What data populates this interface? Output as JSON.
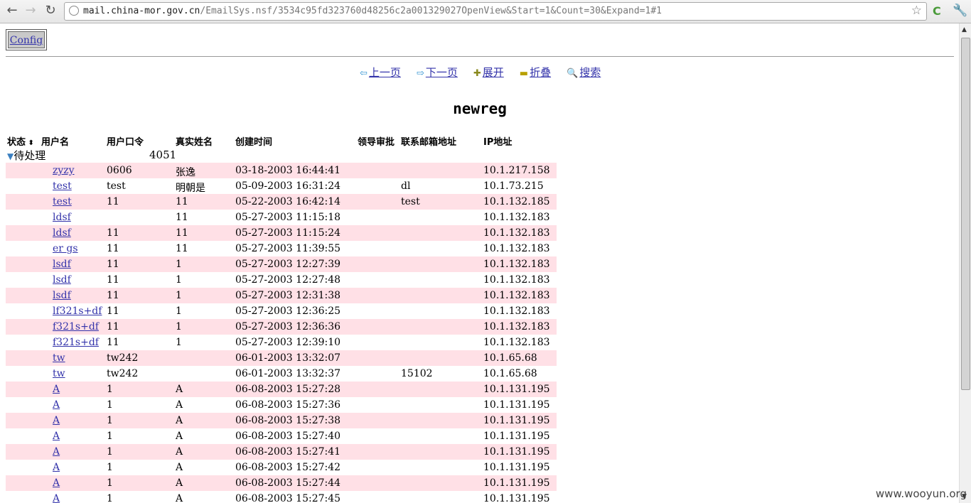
{
  "browser": {
    "url_host": "mail.china-mor.gov.cn",
    "url_rest": "/EmailSys.nsf/3534c95fd323760d48256c2a001329027OpenView&Start=1&Count=30&Expand=1#1"
  },
  "config_label": "Config",
  "toolbar": {
    "prev": "上一页",
    "next": "下一页",
    "expand": "展开",
    "collapse": "折叠",
    "search": "搜索"
  },
  "view_title": "newreg",
  "columns": {
    "status": "状态",
    "username": "用户名",
    "password": "用户口令",
    "realname": "真实姓名",
    "created": "创建时间",
    "approval": "领导审批",
    "email": "联系邮箱地址",
    "ip": "IP地址"
  },
  "group": {
    "label": "待处理",
    "count": "4051"
  },
  "rows": [
    {
      "user": "zyzy",
      "pw": "0606",
      "name": "张逸",
      "time": "03-18-2003 16:44:41",
      "email": "",
      "ip": "10.1.217.158"
    },
    {
      "user": "test",
      "pw": "test",
      "name": "明朝是",
      "time": "05-09-2003 16:31:24",
      "email": "dl",
      "ip": "10.1.73.215"
    },
    {
      "user": "test",
      "pw": "11",
      "name": "11",
      "time": "05-22-2003 16:42:14",
      "email": "test",
      "ip": "10.1.132.185"
    },
    {
      "user": "ldsf",
      "pw": "",
      "name": "11",
      "time": "05-27-2003 11:15:18",
      "email": "",
      "ip": "10.1.132.183"
    },
    {
      "user": "ldsf",
      "pw": "11",
      "name": "11",
      "time": "05-27-2003 11:15:24",
      "email": "",
      "ip": "10.1.132.183"
    },
    {
      "user": "er gs",
      "pw": "11",
      "name": "11",
      "time": "05-27-2003 11:39:55",
      "email": "",
      "ip": "10.1.132.183"
    },
    {
      "user": "lsdf",
      "pw": "11",
      "name": "1",
      "time": "05-27-2003 12:27:39",
      "email": "",
      "ip": "10.1.132.183"
    },
    {
      "user": "lsdf",
      "pw": "11",
      "name": "1",
      "time": "05-27-2003 12:27:48",
      "email": "",
      "ip": "10.1.132.183"
    },
    {
      "user": "lsdf",
      "pw": "11",
      "name": "1",
      "time": "05-27-2003 12:31:38",
      "email": "",
      "ip": "10.1.132.183"
    },
    {
      "user": "lf321s+df",
      "pw": "11",
      "name": "1",
      "time": "05-27-2003 12:36:25",
      "email": "",
      "ip": "10.1.132.183"
    },
    {
      "user": "f321s+df",
      "pw": "11",
      "name": "1",
      "time": "05-27-2003 12:36:36",
      "email": "",
      "ip": "10.1.132.183"
    },
    {
      "user": "f321s+df",
      "pw": "11",
      "name": "1",
      "time": "05-27-2003 12:39:10",
      "email": "",
      "ip": "10.1.132.183"
    },
    {
      "user": "tw",
      "pw": "tw242",
      "name": "",
      "time": "06-01-2003 13:32:07",
      "email": "",
      "ip": "10.1.65.68"
    },
    {
      "user": "tw",
      "pw": "tw242",
      "name": "",
      "time": "06-01-2003 13:32:37",
      "email": "15102",
      "ip": "10.1.65.68"
    },
    {
      "user": "A",
      "pw": "1",
      "name": "A",
      "time": "06-08-2003 15:27:28",
      "email": "",
      "ip": "10.1.131.195"
    },
    {
      "user": "A",
      "pw": "1",
      "name": "A",
      "time": "06-08-2003 15:27:36",
      "email": "",
      "ip": "10.1.131.195"
    },
    {
      "user": "A",
      "pw": "1",
      "name": "A",
      "time": "06-08-2003 15:27:38",
      "email": "",
      "ip": "10.1.131.195"
    },
    {
      "user": "A",
      "pw": "1",
      "name": "A",
      "time": "06-08-2003 15:27:40",
      "email": "",
      "ip": "10.1.131.195"
    },
    {
      "user": "A",
      "pw": "1",
      "name": "A",
      "time": "06-08-2003 15:27:41",
      "email": "",
      "ip": "10.1.131.195"
    },
    {
      "user": "A",
      "pw": "1",
      "name": "A",
      "time": "06-08-2003 15:27:42",
      "email": "",
      "ip": "10.1.131.195"
    },
    {
      "user": "A",
      "pw": "1",
      "name": "A",
      "time": "06-08-2003 15:27:44",
      "email": "",
      "ip": "10.1.131.195"
    },
    {
      "user": "A",
      "pw": "1",
      "name": "A",
      "time": "06-08-2003 15:27:45",
      "email": "",
      "ip": "10.1.131.195"
    }
  ],
  "watermark": "www.wooyun.org",
  "colors": {
    "row_highlight": "#ffe0e6",
    "link": "#3333aa"
  }
}
